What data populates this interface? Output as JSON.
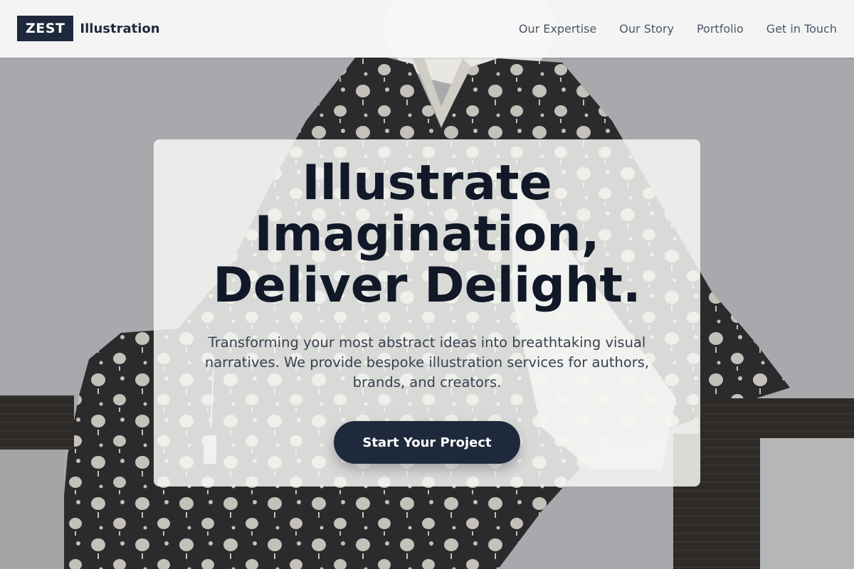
{
  "brand": {
    "mark": "ZEST",
    "name": "Illustration"
  },
  "nav": {
    "items": [
      {
        "label": "Our Expertise"
      },
      {
        "label": "Our Story"
      },
      {
        "label": "Portfolio"
      },
      {
        "label": "Get in Touch"
      }
    ]
  },
  "hero": {
    "title_lines": [
      "Illustrate",
      "Imagination,",
      "Deliver Delight."
    ],
    "subtitle": "Transforming your most abstract ideas into breathtaking visual narratives. We provide bespoke illustration services for authors, brands, and creators.",
    "cta_label": "Start Your Project"
  },
  "colors": {
    "primary": "#1e293b",
    "heading": "#111827",
    "body_text": "#374151",
    "nav_text": "#4b5563",
    "header_bg": "#f7f7f7",
    "card_bg": "#f6f7f3",
    "kimono": "#2b2b2d",
    "dots": "#d8d6cc"
  }
}
